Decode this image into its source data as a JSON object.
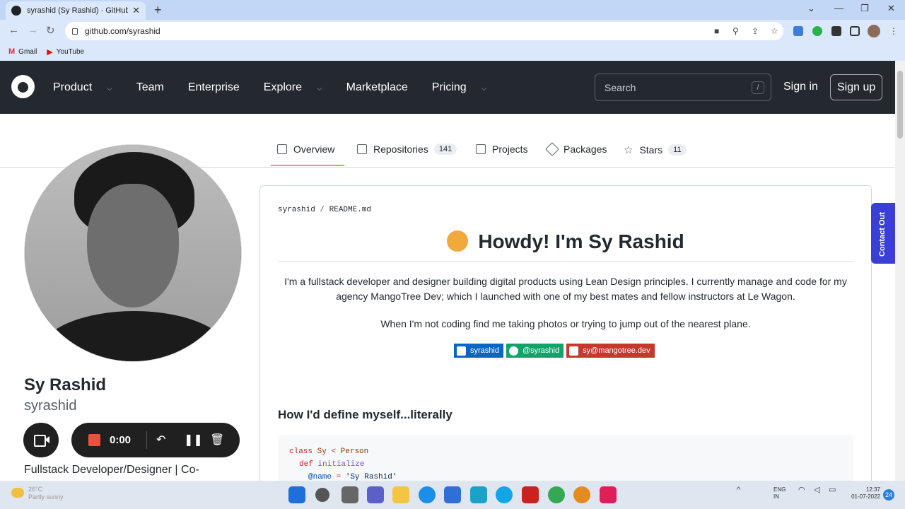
{
  "browser": {
    "tab_title": "syrashid (Sy Rashid) · GitHub",
    "url": "github.com/syrashid",
    "bookmarks": [
      {
        "label": "Gmail",
        "icon": "gmail-icon",
        "color": "#d93025"
      },
      {
        "label": "YouTube",
        "icon": "youtube-icon",
        "color": "#ff0000"
      }
    ]
  },
  "github_header": {
    "nav": [
      {
        "label": "Product",
        "dropdown": true
      },
      {
        "label": "Team",
        "dropdown": false
      },
      {
        "label": "Enterprise",
        "dropdown": false
      },
      {
        "label": "Explore",
        "dropdown": true
      },
      {
        "label": "Marketplace",
        "dropdown": false
      },
      {
        "label": "Pricing",
        "dropdown": true
      }
    ],
    "search_placeholder": "Search",
    "search_shortcut": "/",
    "sign_in": "Sign in",
    "sign_up": "Sign up"
  },
  "profile_tabs": [
    {
      "label": "Overview",
      "icon": "book-icon",
      "count": "",
      "active": true
    },
    {
      "label": "Repositories",
      "icon": "repo-icon",
      "count": "141",
      "active": false
    },
    {
      "label": "Projects",
      "icon": "table-icon",
      "count": "",
      "active": false
    },
    {
      "label": "Packages",
      "icon": "package-icon",
      "count": "",
      "active": false
    },
    {
      "label": "Stars",
      "icon": "star-icon",
      "count": "11",
      "active": false
    }
  ],
  "profile": {
    "name": "Sy Rashid",
    "login": "syrashid",
    "bio": "Fullstack Developer/Designer | Co-"
  },
  "recorder": {
    "time": "0:00"
  },
  "readme": {
    "owner": "syrashid",
    "file": "README.md",
    "heading": "Howdy! I'm Sy Rashid",
    "para1": "I'm a fullstack developer and designer building digital products using Lean Design principles. I currently manage and code for my agency MangoTree Dev; which I launched with one of my best mates and fellow instructors at Le Wagon.",
    "para2": "When I'm not coding find me taking photos or trying to jump out of the nearest plane.",
    "badges": [
      {
        "label": "syrashid",
        "color": "#0a66c2",
        "icon": "linkedin-icon"
      },
      {
        "label": "@syrashid",
        "color": "#12a36a",
        "icon": "medium-icon"
      },
      {
        "label": "sy@mangotree.dev",
        "color": "#c5382c",
        "icon": "gmail-icon"
      }
    ],
    "subheading": "How I'd define myself...literally",
    "code": {
      "line1_kw": "class",
      "line1_cls": "Sy",
      "line1_op": "<",
      "line1_parent": "Person",
      "line2_kw": "def",
      "line2_fn": "initialize",
      "line3_iv": "@name",
      "line3_op": "=",
      "line3_str": "'Sy Rashid'"
    }
  },
  "contact_tab": "Contact Out",
  "taskbar": {
    "weather_temp": "26°C",
    "weather_desc": "Partly sunny",
    "lang1": "ENG",
    "lang2": "IN",
    "time": "12:37",
    "date": "01-07-2022",
    "notifications": "24"
  }
}
